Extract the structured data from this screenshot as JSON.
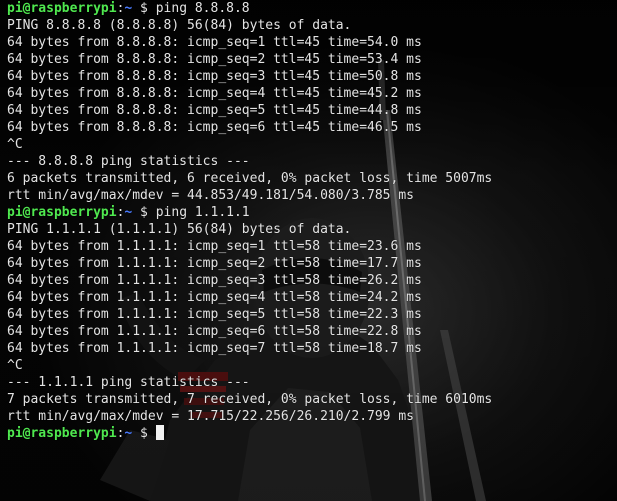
{
  "theme": {
    "background": "#0a0a0a",
    "text_color": "#e4e4e4",
    "user_color": "#4fe84f",
    "path_color": "#4a7bff"
  },
  "prompt": {
    "user_host": "pi@raspberrypi",
    "separator": ":",
    "path": "~",
    "symbol": " $ "
  },
  "session": [
    {
      "type": "prompt",
      "command": "ping 8.8.8.8"
    },
    {
      "type": "output",
      "text": "PING 8.8.8.8 (8.8.8.8) 56(84) bytes of data."
    },
    {
      "type": "output",
      "text": "64 bytes from 8.8.8.8: icmp_seq=1 ttl=45 time=54.0 ms"
    },
    {
      "type": "output",
      "text": "64 bytes from 8.8.8.8: icmp_seq=2 ttl=45 time=53.4 ms"
    },
    {
      "type": "output",
      "text": "64 bytes from 8.8.8.8: icmp_seq=3 ttl=45 time=50.8 ms"
    },
    {
      "type": "output",
      "text": "64 bytes from 8.8.8.8: icmp_seq=4 ttl=45 time=45.2 ms"
    },
    {
      "type": "output",
      "text": "64 bytes from 8.8.8.8: icmp_seq=5 ttl=45 time=44.8 ms"
    },
    {
      "type": "output",
      "text": "64 bytes from 8.8.8.8: icmp_seq=6 ttl=45 time=46.5 ms"
    },
    {
      "type": "output",
      "text": "^C"
    },
    {
      "type": "output",
      "text": "--- 8.8.8.8 ping statistics ---"
    },
    {
      "type": "output",
      "text": "6 packets transmitted, 6 received, 0% packet loss, time 5007ms"
    },
    {
      "type": "output",
      "text": "rtt min/avg/max/mdev = 44.853/49.181/54.080/3.785 ms"
    },
    {
      "type": "prompt",
      "command": "ping 1.1.1.1"
    },
    {
      "type": "output",
      "text": "PING 1.1.1.1 (1.1.1.1) 56(84) bytes of data."
    },
    {
      "type": "output",
      "text": "64 bytes from 1.1.1.1: icmp_seq=1 ttl=58 time=23.6 ms"
    },
    {
      "type": "output",
      "text": "64 bytes from 1.1.1.1: icmp_seq=2 ttl=58 time=17.7 ms"
    },
    {
      "type": "output",
      "text": "64 bytes from 1.1.1.1: icmp_seq=3 ttl=58 time=26.2 ms"
    },
    {
      "type": "output",
      "text": "64 bytes from 1.1.1.1: icmp_seq=4 ttl=58 time=24.2 ms"
    },
    {
      "type": "output",
      "text": "64 bytes from 1.1.1.1: icmp_seq=5 ttl=58 time=22.3 ms"
    },
    {
      "type": "output",
      "text": "64 bytes from 1.1.1.1: icmp_seq=6 ttl=58 time=22.8 ms"
    },
    {
      "type": "output",
      "text": "64 bytes from 1.1.1.1: icmp_seq=7 ttl=58 time=18.7 ms"
    },
    {
      "type": "output",
      "text": "^C"
    },
    {
      "type": "output",
      "text": "--- 1.1.1.1 ping statistics ---"
    },
    {
      "type": "output",
      "text": "7 packets transmitted, 7 received, 0% packet loss, time 6010ms"
    },
    {
      "type": "output",
      "text": "rtt min/avg/max/mdev = 17.715/22.256/26.210/2.799 ms"
    },
    {
      "type": "prompt",
      "command": "",
      "cursor": true
    }
  ]
}
